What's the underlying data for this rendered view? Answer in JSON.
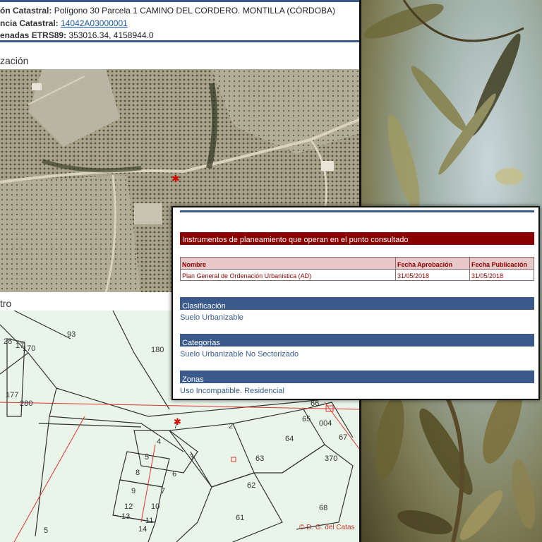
{
  "header": {
    "ref_label": "ón Catastral:",
    "ref_value": "Polígono 30 Parcela 1 CAMINO DEL CORDERO. MONTILLA (CÓRDOBA)",
    "ref2_label": "ncia Catastral:",
    "ref2_value": "14042A03000001",
    "coords_label": "enadas ETRS89:",
    "coords_value": "353016.34, 4158944.0"
  },
  "sections": {
    "location_title": "zación",
    "parcel_title": "tro"
  },
  "parcel_numbers": [
    "93",
    "180",
    "28",
    "17",
    "170",
    "177",
    "280",
    "66",
    "65",
    "004",
    "64",
    "67",
    "2",
    "7",
    "4",
    "63",
    "370",
    "3",
    "5",
    "6",
    "8",
    "62",
    "9",
    "7",
    "12",
    "10",
    "11",
    "13",
    "14",
    "61",
    "68",
    "5"
  ],
  "copyright": "© D. G. del Catas",
  "card": {
    "instruments_title": "Instrumentos de planeamiento que operan en el punto consultado",
    "table": {
      "headers": [
        "Nombre",
        "Fecha Aprobación",
        "Fecha Publicación"
      ],
      "rows": [
        [
          "Plan General de Ordenación Urbanística (AD)",
          "31/05/2018",
          "31/05/2018"
        ]
      ]
    },
    "clasificacion_label": "Clasificación",
    "clasificacion_value": "Suelo Urbanizable",
    "categorias_label": "Categorías",
    "categorias_value": "Suelo Urbanizable No Sectorizado",
    "zonas_label": "Zonas",
    "zonas_value": "Uso Incompatible. Residencial"
  },
  "colors": {
    "accent_blue": "#3a5a8c",
    "section_red": "#8b0000",
    "link": "#1a5aa8",
    "map_green": "#e9f5e9"
  }
}
